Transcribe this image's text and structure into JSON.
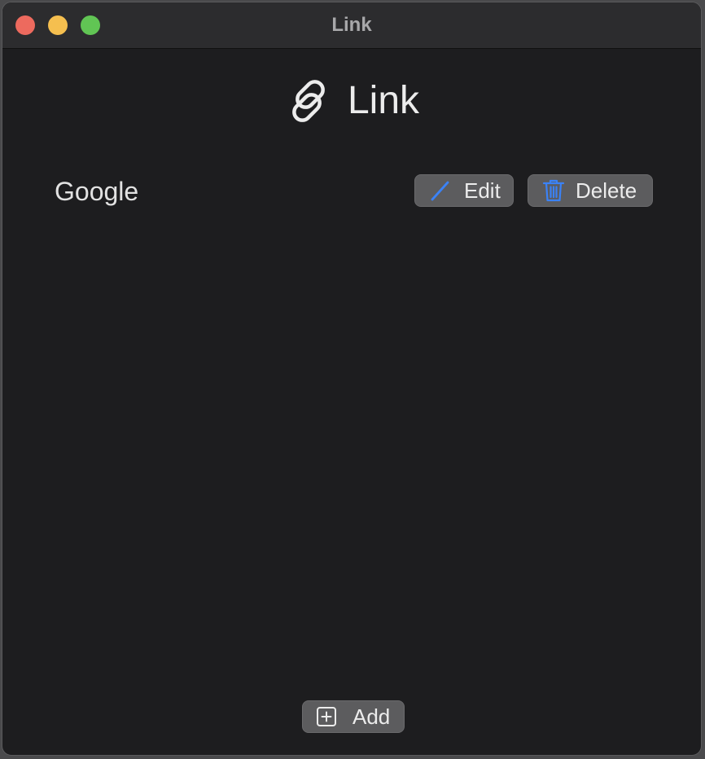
{
  "window": {
    "title": "Link"
  },
  "heading": {
    "icon": "link-icon",
    "text": "Link"
  },
  "links": [
    {
      "name": "Google",
      "edit_label": "Edit",
      "edit_icon": "pencil-icon",
      "delete_label": "Delete",
      "delete_icon": "trash-icon"
    }
  ],
  "footer": {
    "add_label": "Add",
    "add_icon": "plus-square-icon"
  },
  "colors": {
    "accent": "#3b82f6",
    "background": "#1d1d1f",
    "button": "#5c5c5e"
  }
}
